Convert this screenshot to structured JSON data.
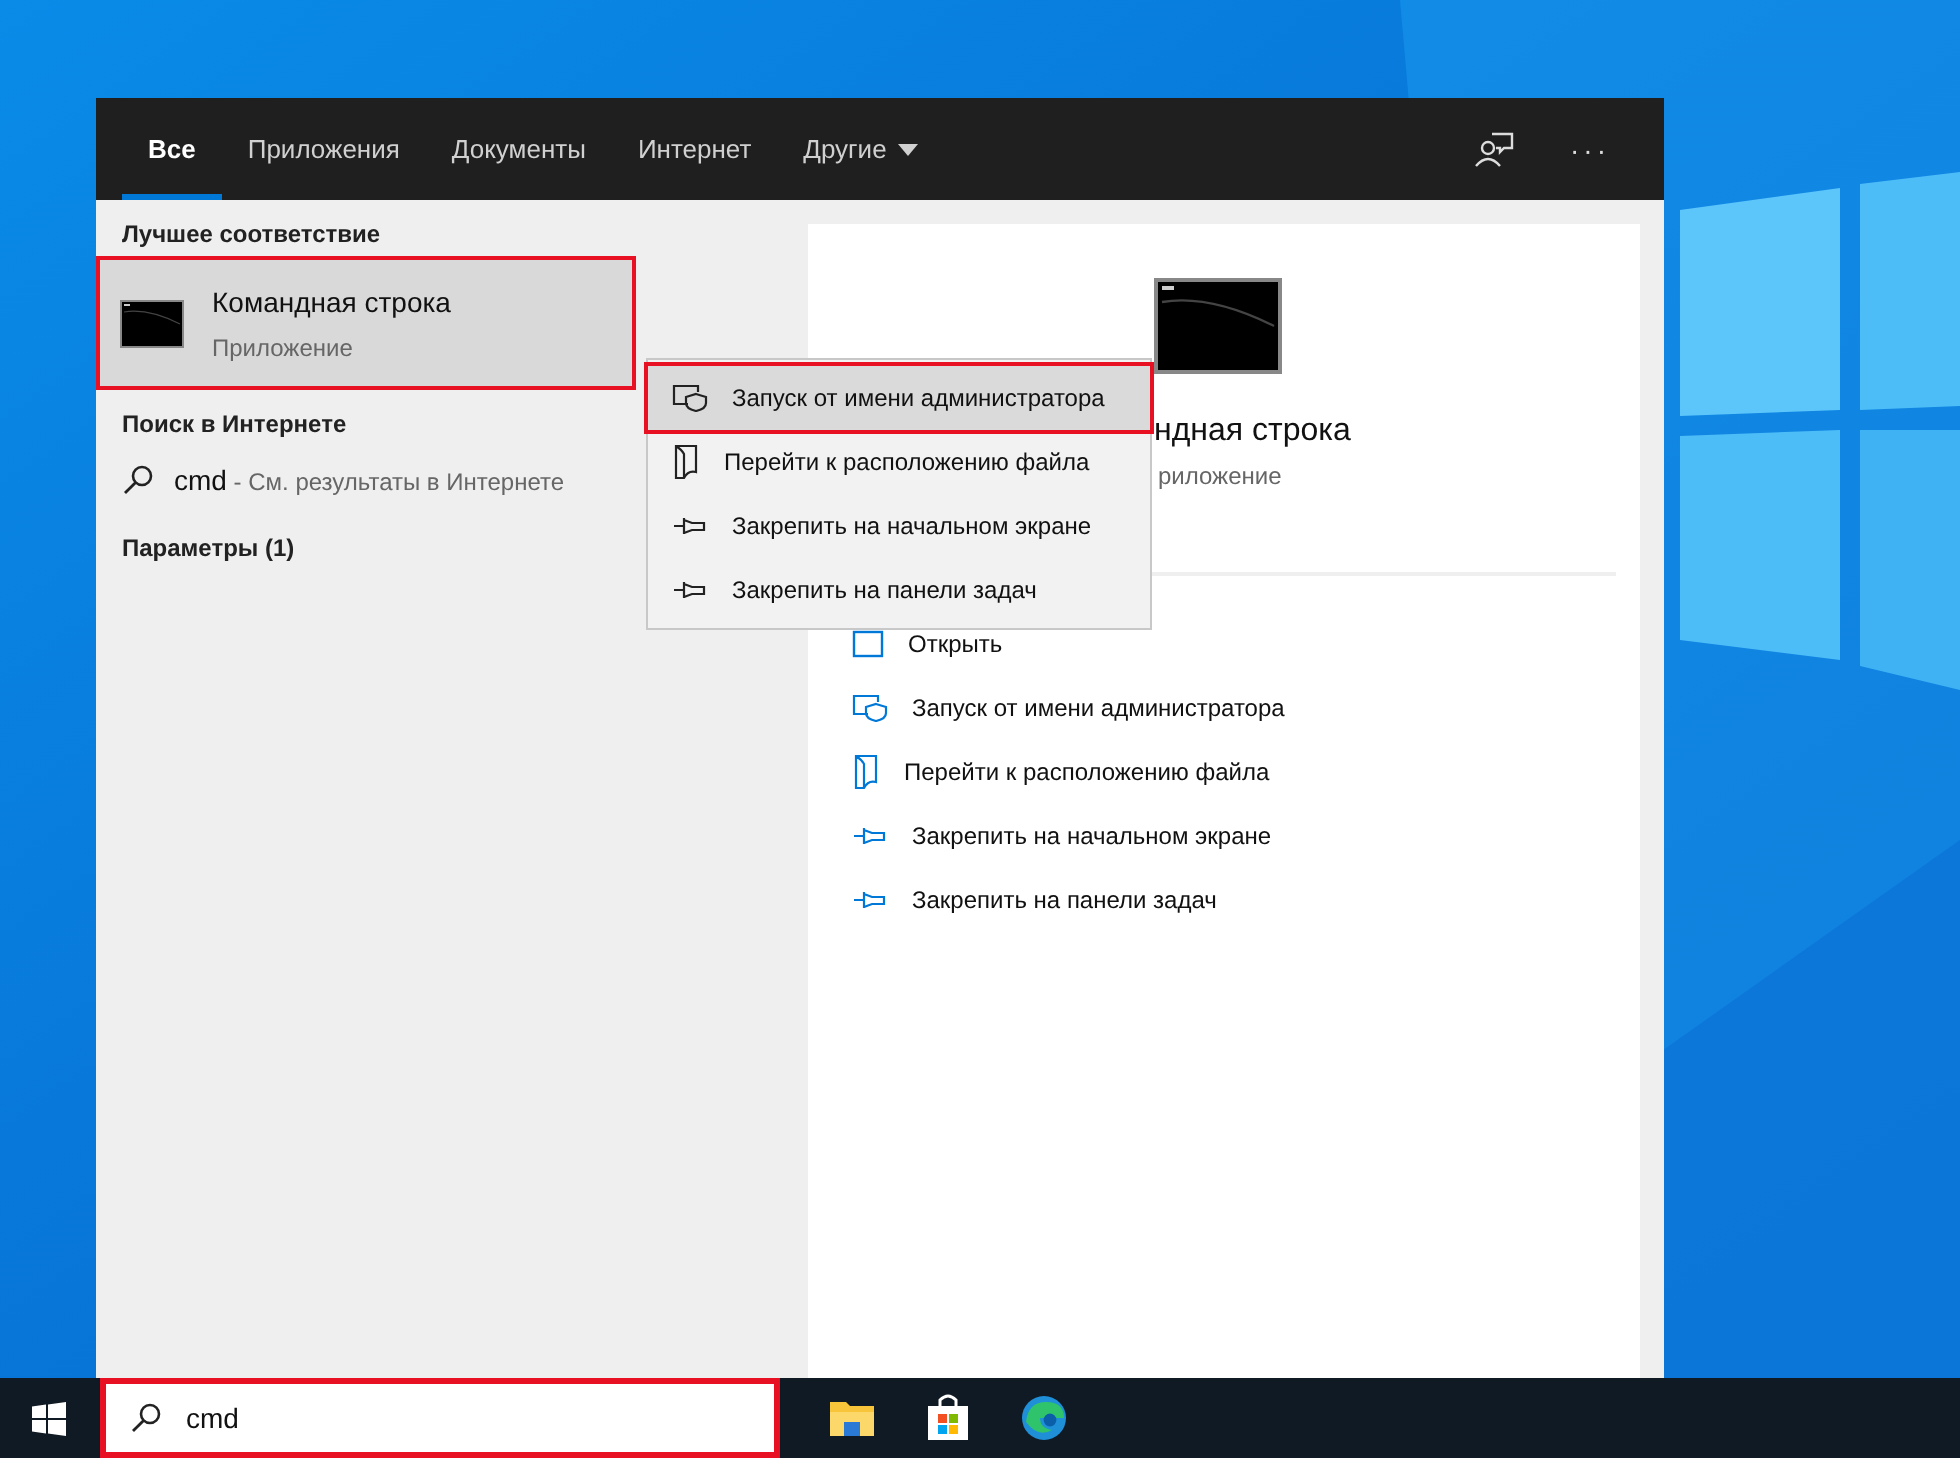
{
  "tabs": [
    {
      "label": "Все",
      "selected": true,
      "dropdown": false
    },
    {
      "label": "Приложения",
      "selected": false,
      "dropdown": false
    },
    {
      "label": "Документы",
      "selected": false,
      "dropdown": false
    },
    {
      "label": "Интернет",
      "selected": false,
      "dropdown": false
    },
    {
      "label": "Другие",
      "selected": false,
      "dropdown": true
    }
  ],
  "header_actions": [
    {
      "kind": "feedback"
    },
    {
      "kind": "more",
      "label": "···"
    }
  ],
  "results": {
    "best_match_heading": "Лучшее соответствие",
    "best_match": {
      "title": "Командная строка",
      "subtitle": "Приложение",
      "selected": true,
      "highlighted": true
    },
    "web_heading": "Поиск в Интернете",
    "web_result": {
      "query": "cmd",
      "hint": " - См. результаты в Интернете"
    },
    "settings_heading": "Параметры (1)"
  },
  "detail": {
    "title": "ндная строка",
    "subtitle": "риложение",
    "actions": [
      {
        "kind": "open",
        "label": "Открыть"
      },
      {
        "kind": "admin",
        "label": "Запуск от имени администратора"
      },
      {
        "kind": "folder",
        "label": "Перейти к расположению файла"
      },
      {
        "kind": "pin",
        "label": "Закрепить на начальном экране"
      },
      {
        "kind": "pin",
        "label": "Закрепить на панели задач"
      }
    ]
  },
  "context_menu": [
    {
      "kind": "admin",
      "label": "Запуск от имени администратора",
      "selected": true,
      "highlighted": true
    },
    {
      "kind": "folder",
      "label": "Перейти к расположению файла",
      "selected": false,
      "highlighted": false
    },
    {
      "kind": "pin",
      "label": "Закрепить на начальном экране",
      "selected": false,
      "highlighted": false
    },
    {
      "kind": "pin",
      "label": "Закрепить на панели задач",
      "selected": false,
      "highlighted": false
    }
  ],
  "taskbar": {
    "search": {
      "value": "cmd",
      "highlighted": true
    },
    "apps": [
      {
        "kind": "explorer"
      },
      {
        "kind": "store"
      },
      {
        "kind": "edge"
      }
    ]
  }
}
